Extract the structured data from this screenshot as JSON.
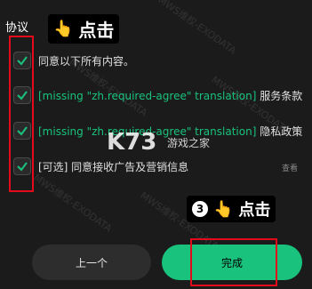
{
  "section": {
    "title": "协议"
  },
  "callouts": {
    "top": {
      "text": "点击",
      "hand": "pointing-hand-icon"
    },
    "bottom": {
      "number": "3",
      "text": "点击",
      "hand": "pointing-hand-icon"
    }
  },
  "items": [
    {
      "checked": true,
      "missing": "",
      "text": "同意以下所有内容。"
    },
    {
      "checked": true,
      "missing": "[missing \"zh.required-agree\" translation]",
      "text": " 服务条款"
    },
    {
      "checked": true,
      "missing": "[missing \"zh.required-agree\" translation]",
      "text": " 隐私政策"
    },
    {
      "checked": true,
      "missing": "",
      "text": "[可选] 同意接收广告及营销信息"
    }
  ],
  "view_link": "查看",
  "watermark": {
    "logo": "K73",
    "logo_sub": "游戏之家",
    "text": "MWS维权-EXODATA"
  },
  "buttons": {
    "prev": "上一个",
    "done": "完成"
  },
  "colors": {
    "background": "#1b1b1b",
    "accent_green": "#19c37d",
    "highlight_red": "#e10b19"
  }
}
